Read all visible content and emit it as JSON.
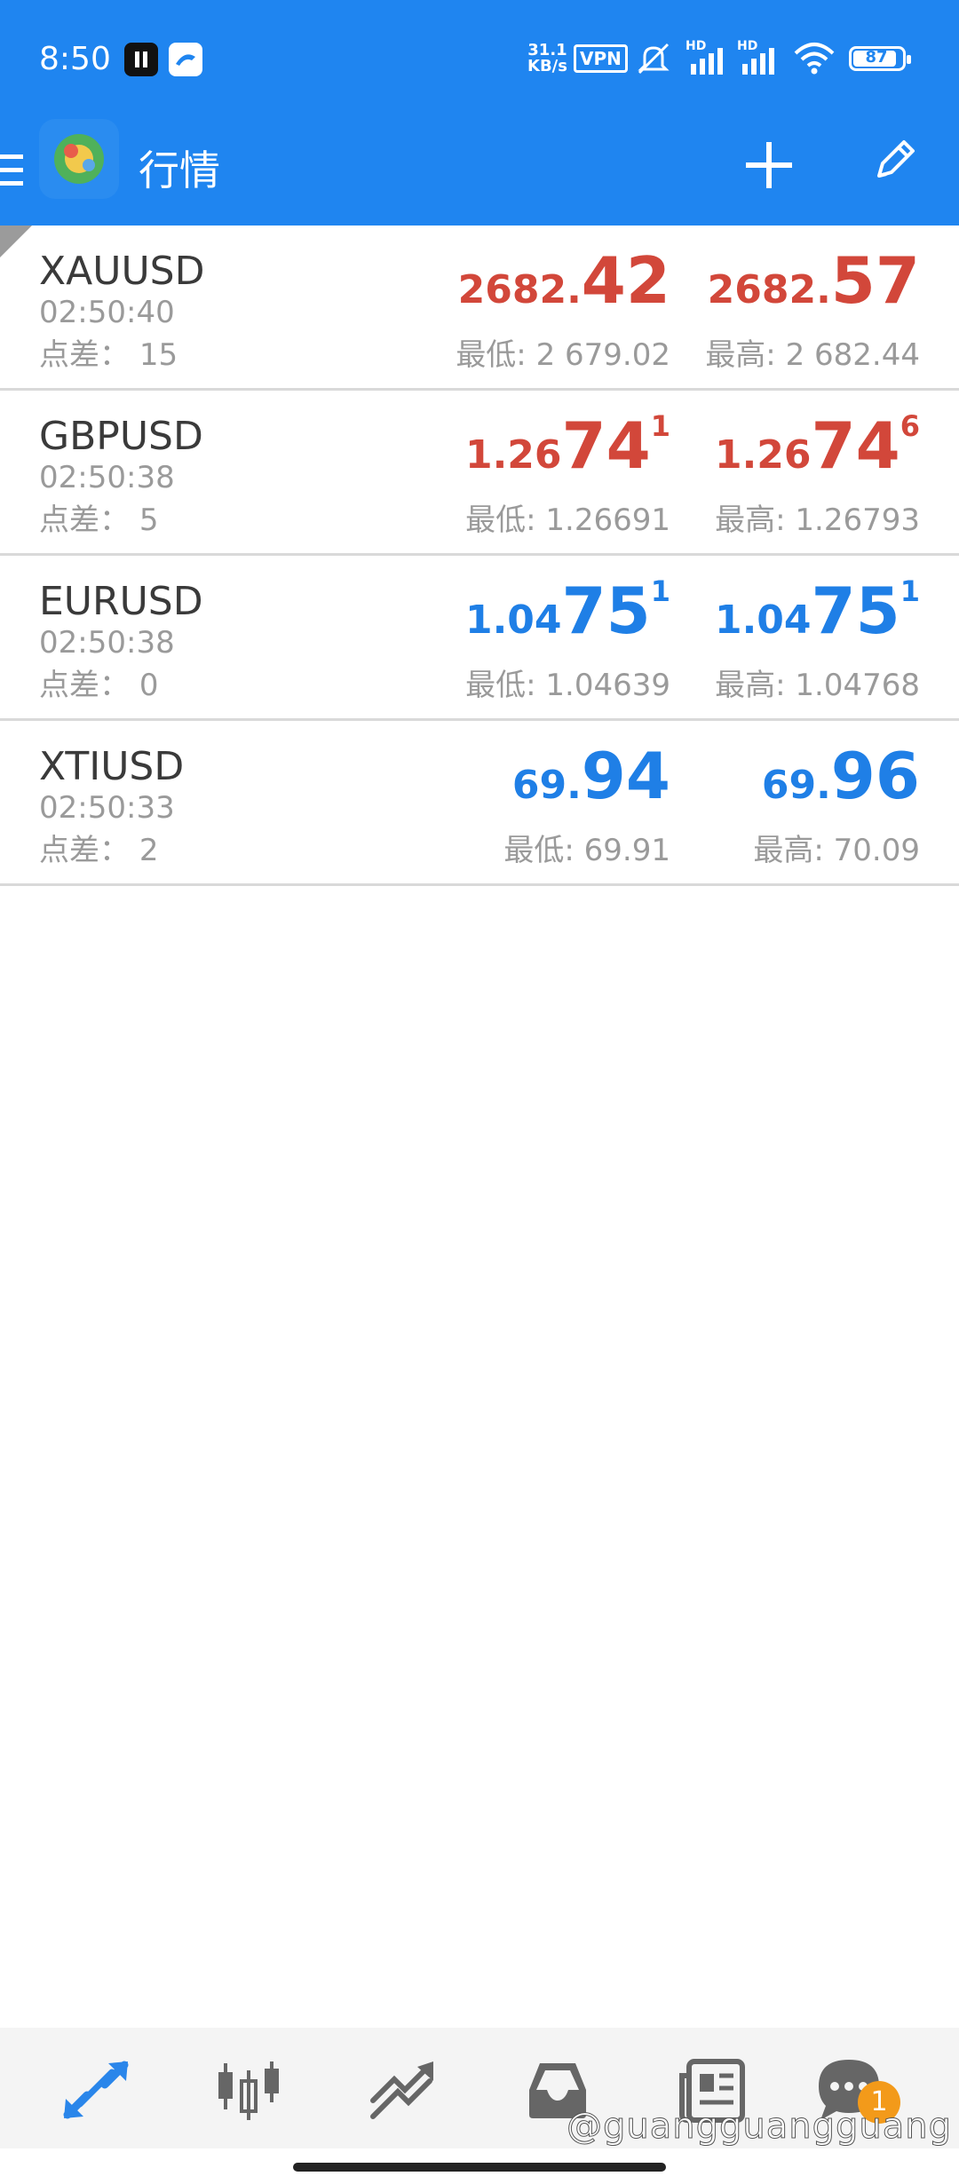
{
  "status": {
    "time": "8:50",
    "net_speed_top": "31.1",
    "net_speed_bottom": "KB/s",
    "vpn": "VPN",
    "hd1": "HD",
    "hd2": "HD",
    "battery": "87"
  },
  "header": {
    "title": "行情"
  },
  "quotes": [
    {
      "symbol": "XAUUSD",
      "time": "02:50:40",
      "spread_label": "点差：",
      "spread": "15",
      "color": "#d2473a",
      "bid_small": "2682.",
      "bid_big": "42",
      "bid_sup": "",
      "ask_small": "2682.",
      "ask_big": "57",
      "ask_sup": "",
      "low_label": "最低:",
      "low": "2 679.02",
      "high_label": "最高:",
      "high": "2 682.44"
    },
    {
      "symbol": "GBPUSD",
      "time": "02:50:38",
      "spread_label": "点差：",
      "spread": "5",
      "color": "#d2473a",
      "bid_small": "1.26",
      "bid_big": "74",
      "bid_sup": "1",
      "ask_small": "1.26",
      "ask_big": "74",
      "ask_sup": "6",
      "low_label": "最低:",
      "low": "1.26691",
      "high_label": "最高:",
      "high": "1.26793"
    },
    {
      "symbol": "EURUSD",
      "time": "02:50:38",
      "spread_label": "点差：",
      "spread": "0",
      "color": "#1f7fe6",
      "bid_small": "1.04",
      "bid_big": "75",
      "bid_sup": "1",
      "ask_small": "1.04",
      "ask_big": "75",
      "ask_sup": "1",
      "low_label": "最低:",
      "low": "1.04639",
      "high_label": "最高:",
      "high": "1.04768"
    },
    {
      "symbol": "XTIUSD",
      "time": "02:50:33",
      "spread_label": "点差：",
      "spread": "2",
      "color": "#1f7fe6",
      "bid_small": "69.",
      "bid_big": "94",
      "bid_sup": "",
      "ask_small": "69.",
      "ask_big": "96",
      "ask_sup": "",
      "low_label": "最低:",
      "low": "69.91",
      "high_label": "最高:",
      "high": "70.09"
    }
  ],
  "bottom_nav": {
    "chat_badge": "1",
    "watermark": "@guangguangguang"
  },
  "colors": {
    "accent": "#1f85f0",
    "up": "#d2473a",
    "down": "#1f7fe6"
  }
}
